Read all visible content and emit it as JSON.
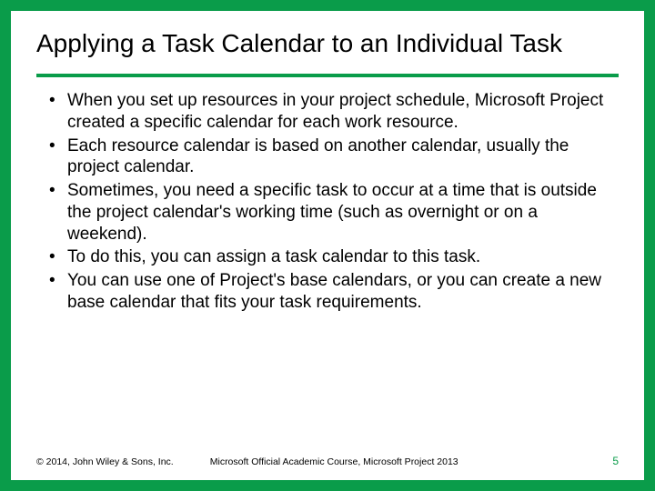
{
  "title": "Applying a Task Calendar to an Individual Task",
  "bullets": [
    "When you set up resources in your project schedule, Microsoft Project created a specific calendar for each work resource.",
    "Each resource calendar is based on another calendar, usually the project calendar.",
    "Sometimes, you need a specific task to occur at a time that is outside the project calendar's working time (such as overnight or on a weekend).",
    "To do this, you can assign a task calendar to this task.",
    "You can use one of Project's base calendars, or you can create a new base calendar that fits your task requirements."
  ],
  "footer": {
    "copyright": "© 2014, John Wiley & Sons, Inc.",
    "course": "Microsoft Official Academic Course, Microsoft Project 2013",
    "page": "5"
  }
}
